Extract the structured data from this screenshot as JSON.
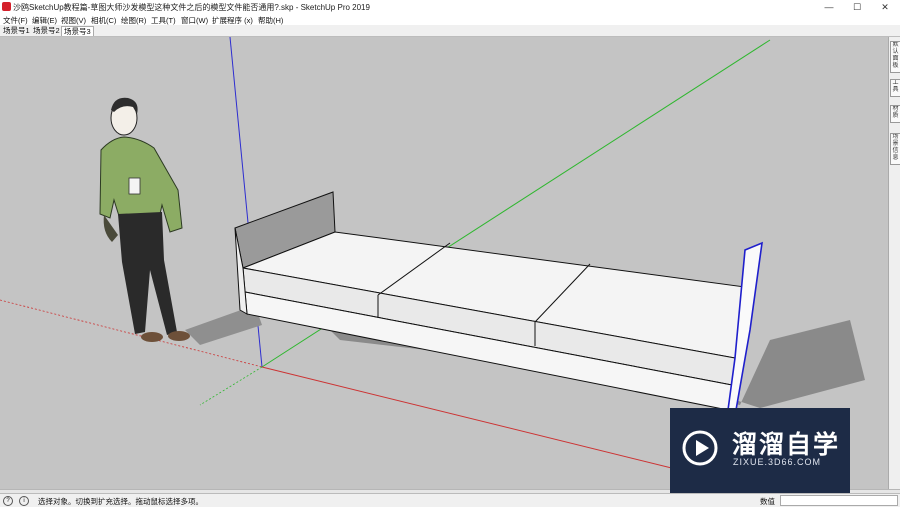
{
  "window": {
    "title": "沙鸥SketchUp教程篇-草图大师沙发模型这种文件之后的模型文件能否通用?.skp - SketchUp Pro 2019",
    "minimize": "—",
    "maximize": "☐",
    "close": "✕"
  },
  "menus": [
    "文件(F)",
    "编辑(E)",
    "视图(V)",
    "相机(C)",
    "绘图(R)",
    "工具(T)",
    "窗口(W)",
    "扩展程序 (x)",
    "帮助(H)"
  ],
  "scene_tabs": [
    "场景号1",
    "场景号2",
    "场景号3"
  ],
  "active_tab": 2,
  "right_panel_tabs": [
    "默认面板",
    "工具",
    "材质",
    "场景信息"
  ],
  "status": {
    "message": "选择对象。切换到扩充选择。拖动鼠标选择多项。",
    "measurements_label": "数值",
    "measurements_value": ""
  },
  "watermark": {
    "title": "溜溜自学",
    "url": "ZIXUE.3D66.COM"
  },
  "colors": {
    "viewport_background": "#c4c4c4",
    "axis_red": "#cc3333",
    "axis_green": "#2fb72f",
    "axis_blue": "#2d2dd0",
    "watermark_background": "#1d2b46"
  }
}
